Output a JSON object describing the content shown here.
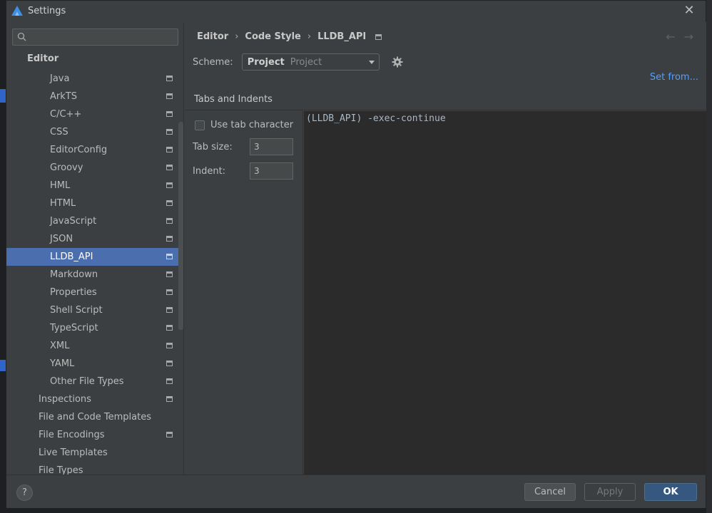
{
  "window": {
    "title": "Settings"
  },
  "search": {
    "placeholder": "",
    "value": ""
  },
  "sidebar": {
    "section": "Editor",
    "items": [
      {
        "label": "Java",
        "level": 2,
        "project_icon": true
      },
      {
        "label": "ArkTS",
        "level": 2,
        "project_icon": true
      },
      {
        "label": "C/C++",
        "level": 2,
        "project_icon": true
      },
      {
        "label": "CSS",
        "level": 2,
        "project_icon": true
      },
      {
        "label": "EditorConfig",
        "level": 2,
        "project_icon": true
      },
      {
        "label": "Groovy",
        "level": 2,
        "project_icon": true
      },
      {
        "label": "HML",
        "level": 2,
        "project_icon": true
      },
      {
        "label": "HTML",
        "level": 2,
        "project_icon": true
      },
      {
        "label": "JavaScript",
        "level": 2,
        "project_icon": true
      },
      {
        "label": "JSON",
        "level": 2,
        "project_icon": true
      },
      {
        "label": "LLDB_API",
        "level": 2,
        "project_icon": true,
        "selected": true
      },
      {
        "label": "Markdown",
        "level": 2,
        "project_icon": true
      },
      {
        "label": "Properties",
        "level": 2,
        "project_icon": true
      },
      {
        "label": "Shell Script",
        "level": 2,
        "project_icon": true
      },
      {
        "label": "TypeScript",
        "level": 2,
        "project_icon": true
      },
      {
        "label": "XML",
        "level": 2,
        "project_icon": true
      },
      {
        "label": "YAML",
        "level": 2,
        "project_icon": true
      },
      {
        "label": "Other File Types",
        "level": 2,
        "project_icon": true
      },
      {
        "label": "Inspections",
        "level": 1,
        "project_icon": true
      },
      {
        "label": "File and Code Templates",
        "level": 1,
        "project_icon": false
      },
      {
        "label": "File Encodings",
        "level": 1,
        "project_icon": true
      },
      {
        "label": "Live Templates",
        "level": 1,
        "project_icon": false
      },
      {
        "label": "File Types",
        "level": 1,
        "project_icon": false
      }
    ]
  },
  "breadcrumb": {
    "items": [
      "Editor",
      "Code Style",
      "LLDB_API"
    ],
    "separator": "›"
  },
  "nav": {
    "back": "←",
    "forward": "→"
  },
  "scheme": {
    "label": "Scheme:",
    "value": "Project",
    "hint": "Project"
  },
  "set_from": "Set from...",
  "tabs": [
    {
      "label": "Tabs and Indents"
    }
  ],
  "options": {
    "use_tab_character": {
      "label": "Use tab character",
      "checked": false
    },
    "tab_size": {
      "label": "Tab size:",
      "value": "3"
    },
    "indent": {
      "label": "Indent:",
      "value": "3"
    }
  },
  "preview": {
    "code": "(LLDB_API) -exec-continue"
  },
  "footer": {
    "help": "?",
    "cancel": "Cancel",
    "apply": "Apply",
    "ok": "OK"
  },
  "colors": {
    "accent": "#4b6eaf",
    "link": "#589df6",
    "ok_button": "#365880",
    "background": "#3c3f41",
    "editor_background": "#2b2b2b"
  }
}
